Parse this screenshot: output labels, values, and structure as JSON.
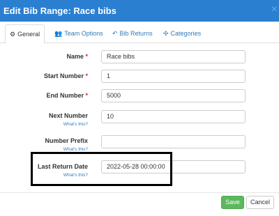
{
  "dialog": {
    "title": "Edit Bib Range: Race bibs",
    "close_icon": "×"
  },
  "tabs": [
    {
      "label": "General",
      "icon": "gears-icon",
      "glyph": "⚙"
    },
    {
      "label": "Team Options",
      "icon": "users-icon",
      "glyph": "👥"
    },
    {
      "label": "Bib Returns",
      "icon": "undo-icon",
      "glyph": "↶"
    },
    {
      "label": "Categories",
      "icon": "sitemap-icon",
      "glyph": "✣"
    }
  ],
  "form": {
    "required_mark": "*",
    "help_text": "What's this?",
    "fields": [
      {
        "label": "Name",
        "required": true,
        "value": "Race bibs"
      },
      {
        "label": "Start Number",
        "required": true,
        "value": "1"
      },
      {
        "label": "End Number",
        "required": true,
        "value": "5000"
      },
      {
        "label": "Next Number",
        "required": false,
        "value": "10"
      },
      {
        "label": "Number Prefix",
        "required": false,
        "value": ""
      },
      {
        "label": "Last Return Date",
        "required": false,
        "value": "2022-05-28 00:00:00"
      }
    ]
  },
  "footer": {
    "save_label": "Save",
    "cancel_label": "Cancel"
  },
  "colors": {
    "header": "#2a7fd0",
    "link": "#337ab7",
    "save": "#5cb85c",
    "required": "#c9302c"
  }
}
